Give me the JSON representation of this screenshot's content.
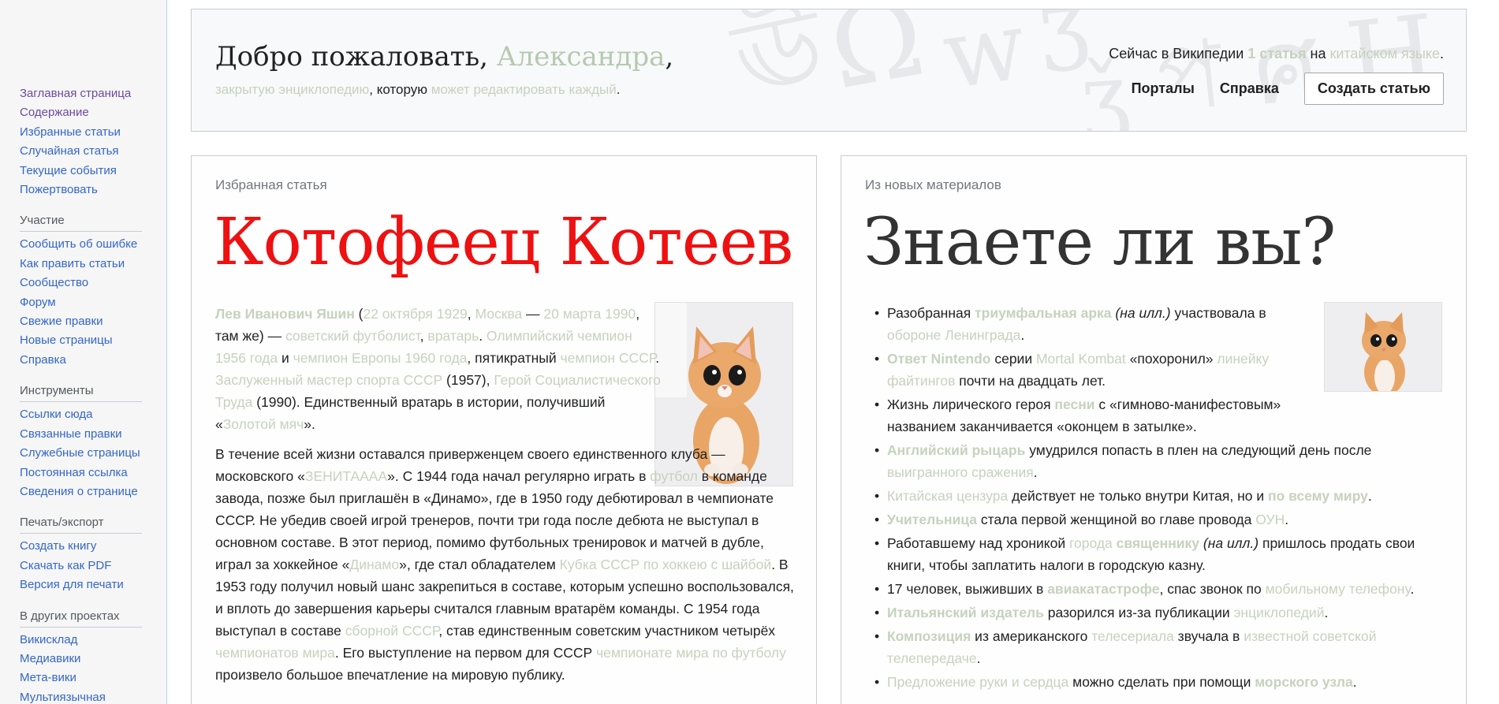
{
  "sidebar": {
    "main": [
      {
        "label": "Заглавная страница",
        "visited": true
      },
      {
        "label": "Содержание",
        "visited": true
      },
      {
        "label": "Избранные статьи",
        "visited": false
      },
      {
        "label": "Случайная статья",
        "visited": false
      },
      {
        "label": "Текущие события",
        "visited": false
      },
      {
        "label": "Пожертвовать",
        "visited": false
      }
    ],
    "participation": {
      "heading": "Участие",
      "items": [
        "Сообщить об ошибке",
        "Как править статьи",
        "Сообщество",
        "Форум",
        "Свежие правки",
        "Новые страницы",
        "Справка"
      ]
    },
    "tools": {
      "heading": "Инструменты",
      "items": [
        "Ссылки сюда",
        "Связанные правки",
        "Служебные страницы",
        "Постоянная ссылка",
        "Сведения о странице"
      ]
    },
    "print": {
      "heading": "Печать/экспорт",
      "items": [
        "Создать книгу",
        "Скачать как PDF",
        "Версия для печати"
      ]
    },
    "projects": {
      "heading": "В других проектах",
      "items": [
        "Викисклад",
        "Медиавики",
        "Мета-вики",
        "Мультиязычная"
      ]
    }
  },
  "welcome": {
    "title_prefix": "Добро пожаловать, ",
    "title_name": "Александра",
    "title_suffix": ",",
    "sub_link1": "закрытую энциклопедию",
    "sub_text1": ", которую ",
    "sub_link2": "может редактировать каждый",
    "sub_text2": ".",
    "stats_prefix": "Сейчас в Википедии ",
    "stats_count": "1 статья",
    "stats_mid": " на ",
    "stats_lang": "китайском языке",
    "stats_suffix": ".",
    "nav_portals": "Порталы",
    "nav_help": "Справка",
    "create_button": "Создать статью"
  },
  "featured": {
    "label": "Избранная статья",
    "title": "Котофеец Котеев",
    "p1": [
      {
        "t": "Лев Иванович Яшин",
        "s": "fb"
      },
      {
        "t": " (",
        "s": "n"
      },
      {
        "t": "22 октября 1929",
        "s": "f"
      },
      {
        "t": ", ",
        "s": "n"
      },
      {
        "t": "Москва",
        "s": "f"
      },
      {
        "t": " — ",
        "s": "n"
      },
      {
        "t": "20 марта 1990",
        "s": "f"
      },
      {
        "t": ", там же) — ",
        "s": "n"
      },
      {
        "t": "советский футболист",
        "s": "f"
      },
      {
        "t": ", ",
        "s": "n"
      },
      {
        "t": "вратарь",
        "s": "f"
      },
      {
        "t": ". ",
        "s": "n"
      },
      {
        "t": "Олимпийский чемпион 1956 года",
        "s": "f"
      },
      {
        "t": " и ",
        "s": "n"
      },
      {
        "t": "чемпион Европы 1960 года",
        "s": "f"
      },
      {
        "t": ", пятикратный ",
        "s": "n"
      },
      {
        "t": "чемпион СССР",
        "s": "f"
      },
      {
        "t": ". ",
        "s": "n"
      },
      {
        "t": "Заслуженный мастер спорта СССР",
        "s": "f"
      },
      {
        "t": " (1957), ",
        "s": "n"
      },
      {
        "t": "Герой Социалистического Труда",
        "s": "f"
      },
      {
        "t": " (1990). Единственный вратарь в истории, получивший «",
        "s": "n"
      },
      {
        "t": "Золотой мяч",
        "s": "f"
      },
      {
        "t": "».",
        "s": "n"
      }
    ],
    "p2": [
      {
        "t": "В течение всей жизни оставался приверженцем своего единственного клуба — московского «",
        "s": "n"
      },
      {
        "t": "ЗЕНИТАААА",
        "s": "f"
      },
      {
        "t": "». С 1944 года начал регулярно играть в ",
        "s": "n"
      },
      {
        "t": "футбол",
        "s": "f"
      },
      {
        "t": " в команде завода, позже был приглашён в «Динамо», где в 1950 году дебютировал в чемпионате СССР. Не убедив своей игрой тренеров, почти три года после дебюта не выступал в основном составе. В этот период, помимо футбольных тренировок и матчей в дубле, играл за хоккейное «",
        "s": "n"
      },
      {
        "t": "Динамо",
        "s": "f"
      },
      {
        "t": "», где стал обладателем ",
        "s": "n"
      },
      {
        "t": "Кубка СССР по хоккею с шайбой",
        "s": "f"
      },
      {
        "t": ". В 1953 году получил новый шанс закрепиться в составе, которым успешно воспользовался, и вплоть до завершения карьеры считался главным вратарём команды. С 1954 года выступал в составе ",
        "s": "n"
      },
      {
        "t": "сборной СССР",
        "s": "f"
      },
      {
        "t": ", став единственным советским участником четырёх ",
        "s": "n"
      },
      {
        "t": "чемпионатов мира",
        "s": "f"
      },
      {
        "t": ". Его выступление на первом для СССР ",
        "s": "n"
      },
      {
        "t": "чемпионате мира по футболу",
        "s": "f"
      },
      {
        "t": " произвело большое впечатление на мировую публику.",
        "s": "n"
      }
    ]
  },
  "dyk": {
    "label": "Из новых материалов",
    "title": "Знаете ли вы?",
    "items": [
      {
        "narrow": true,
        "parts": [
          {
            "t": "Разобранная ",
            "s": "n"
          },
          {
            "t": "триумфальная арка",
            "s": "fb"
          },
          {
            "t": " ",
            "s": "n"
          },
          {
            "t": "(на илл.)",
            "s": "i"
          },
          {
            "t": " участвовала в ",
            "s": "n"
          },
          {
            "t": "обороне Ленинграда",
            "s": "f"
          },
          {
            "t": ".",
            "s": "n"
          }
        ]
      },
      {
        "narrow": true,
        "parts": [
          {
            "t": "Ответ Nintendo",
            "s": "fb"
          },
          {
            "t": " серии ",
            "s": "n"
          },
          {
            "t": "Mortal Kombat",
            "s": "f"
          },
          {
            "t": " «похоронил» ",
            "s": "n"
          },
          {
            "t": "линейку файтингов",
            "s": "f"
          },
          {
            "t": " почти на двадцать лет.",
            "s": "n"
          }
        ]
      },
      {
        "narrow": true,
        "parts": [
          {
            "t": "Жизнь лирического героя ",
            "s": "n"
          },
          {
            "t": "песни",
            "s": "fb"
          },
          {
            "t": " с «гимново-манифестовым» названием заканчивается «оконцем в затылке».",
            "s": "n"
          }
        ]
      },
      {
        "narrow": false,
        "parts": [
          {
            "t": "Английский рыцарь",
            "s": "fb"
          },
          {
            "t": " умудрился попасть в плен на следующий день после ",
            "s": "n"
          },
          {
            "t": "выигранного сражения",
            "s": "f"
          },
          {
            "t": ".",
            "s": "n"
          }
        ]
      },
      {
        "narrow": false,
        "parts": [
          {
            "t": "Китайская цензура",
            "s": "f"
          },
          {
            "t": " действует не только внутри Китая, но и ",
            "s": "n"
          },
          {
            "t": "по всему миру",
            "s": "fb"
          },
          {
            "t": ".",
            "s": "n"
          }
        ]
      },
      {
        "narrow": false,
        "parts": [
          {
            "t": "Учительница",
            "s": "fb"
          },
          {
            "t": " стала первой женщиной во главе провода ",
            "s": "n"
          },
          {
            "t": "ОУН",
            "s": "f"
          },
          {
            "t": ".",
            "s": "n"
          }
        ]
      },
      {
        "narrow": false,
        "parts": [
          {
            "t": "Работавшему над хроникой ",
            "s": "n"
          },
          {
            "t": "города",
            "s": "f"
          },
          {
            "t": " ",
            "s": "n"
          },
          {
            "t": "священнику",
            "s": "fb"
          },
          {
            "t": " ",
            "s": "n"
          },
          {
            "t": "(на илл.)",
            "s": "i"
          },
          {
            "t": " пришлось продать свои книги, чтобы заплатить налоги в городскую казну.",
            "s": "n"
          }
        ]
      },
      {
        "narrow": false,
        "parts": [
          {
            "t": "17 человек, выживших в ",
            "s": "n"
          },
          {
            "t": "авиакатастрофе",
            "s": "fb"
          },
          {
            "t": ", спас звонок по ",
            "s": "n"
          },
          {
            "t": "мобильному телефону",
            "s": "f"
          },
          {
            "t": ".",
            "s": "n"
          }
        ]
      },
      {
        "narrow": false,
        "parts": [
          {
            "t": "Итальянский издатель",
            "s": "fb"
          },
          {
            "t": " разорился из-за публикации ",
            "s": "n"
          },
          {
            "t": "энциклопедий",
            "s": "f"
          },
          {
            "t": ".",
            "s": "n"
          }
        ]
      },
      {
        "narrow": false,
        "parts": [
          {
            "t": "Композиция",
            "s": "fb"
          },
          {
            "t": " из американского ",
            "s": "n"
          },
          {
            "t": "телесериала",
            "s": "f"
          },
          {
            "t": " звучала в ",
            "s": "n"
          },
          {
            "t": "известной советской телепередаче",
            "s": "f"
          },
          {
            "t": ".",
            "s": "n"
          }
        ]
      },
      {
        "narrow": false,
        "parts": [
          {
            "t": "Предложение руки и сердца",
            "s": "f"
          },
          {
            "t": " можно сделать при помощи ",
            "s": "n"
          },
          {
            "t": "морского узла",
            "s": "fb"
          },
          {
            "t": ".",
            "s": "n"
          }
        ]
      }
    ]
  },
  "colors": {
    "link": "#3366cc",
    "visited": "#6b4ba1",
    "faded_link": "#c5d2bd",
    "featured_title": "#ee1111"
  }
}
